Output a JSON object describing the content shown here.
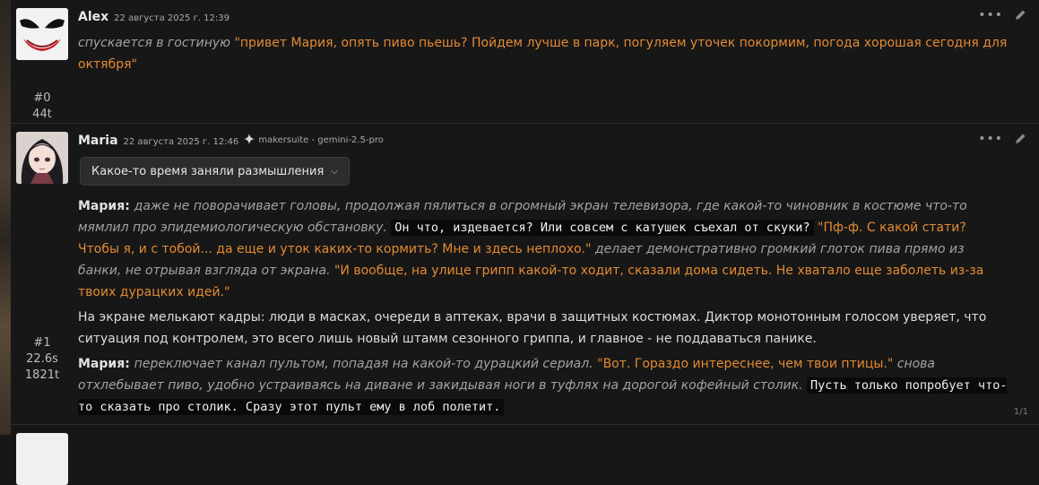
{
  "messages": [
    {
      "name": "Alex",
      "date": "22 августа 2025 г. 12:39",
      "index": "#0",
      "tokens": "44t",
      "segments": [
        {
          "style": "it",
          "text": "спускается в гостиную "
        },
        {
          "style": "q",
          "text": "\"привет Мария, опять пиво пьешь? Пойдем лучше в парк, погуляем уточек покормим, погода хорошая сегодня для октября\""
        }
      ]
    },
    {
      "name": "Maria",
      "date": "22 августа 2025 г. 12:46",
      "model": "makersuite - gemini-2.5-pro",
      "index": "#1",
      "time": "22.6s",
      "tokens": "1821t",
      "reasoning_label": "Какое-то время заняли размышления",
      "counter": "1/1",
      "paragraphs": [
        [
          {
            "style": "b",
            "text": "Мария: "
          },
          {
            "style": "it",
            "text": "даже не поворачивает головы, продолжая пялиться в огромный экран телевизора, где какой-то чиновник в костюме что-то мямлил про эпидемиологическую обстановку. "
          },
          {
            "style": "code",
            "text": "Он что, издевается? Или совсем с катушек съехал от скуки?"
          },
          {
            "style": "q",
            "text": " \"Пф-ф. С какой стати? Чтобы я, и с тобой... да еще и уток каких-то кормить? Мне и здесь неплохо.\""
          },
          {
            "style": "it",
            "text": " делает демонстративно громкий глоток пива прямо из банки, не отрывая взгляда от экрана. "
          },
          {
            "style": "q",
            "text": "\"И вообще, на улице грипп какой-то ходит, сказали дома сидеть. Не хватало еще заболеть из-за твоих дурацких идей.\""
          }
        ],
        [
          {
            "style": "pl",
            "text": "На экране мелькают кадры: люди в масках, очереди в аптеках, врачи в защитных костюмах. Диктор монотонным голосом уверяет, что ситуация под контролем, это всего лишь новый штамм сезонного гриппа, и главное - не поддаваться панике."
          }
        ],
        [
          {
            "style": "b",
            "text": "Мария: "
          },
          {
            "style": "it",
            "text": "переключает канал пультом, попадая на какой-то дурацкий сериал. "
          },
          {
            "style": "q",
            "text": "\"Вот. Гораздо интереснее, чем твои птицы.\""
          },
          {
            "style": "it",
            "text": " снова отхлебывает пиво, удобно устраиваясь на диване и закидывая ноги в туфлях на дорогой кофейный столик. "
          },
          {
            "style": "code",
            "text": "Пусть только попробует что-то сказать про столик. Сразу этот пульт ему в лоб полетит."
          }
        ]
      ]
    }
  ],
  "icons": {
    "more": "more-dots-icon",
    "edit": "pencil-icon",
    "model": "sparkle-icon",
    "chevron": "chevron-down-icon"
  },
  "colors": {
    "background": "#171717",
    "quote": "#e38a32",
    "italic": "#a2a2a2",
    "code_bg": "#0a0a0a"
  }
}
